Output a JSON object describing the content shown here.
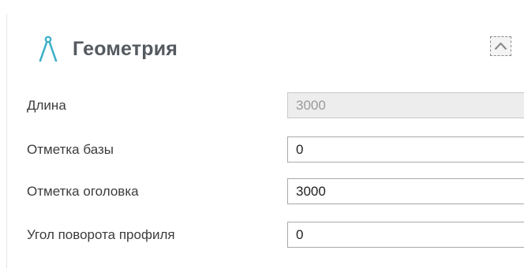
{
  "section": {
    "title": "Геометрия",
    "icon": "compass-icon",
    "icon_color": "#3fb0c9",
    "collapse_icon": "chevron-up-icon"
  },
  "fields": [
    {
      "label": "Длина",
      "value": "3000",
      "readonly": true
    },
    {
      "label": "Отметка базы",
      "value": "0",
      "readonly": false
    },
    {
      "label": "Отметка оголовка",
      "value": "3000",
      "readonly": false
    },
    {
      "label": "Угол поворота профиля",
      "value": "0",
      "readonly": false
    }
  ]
}
